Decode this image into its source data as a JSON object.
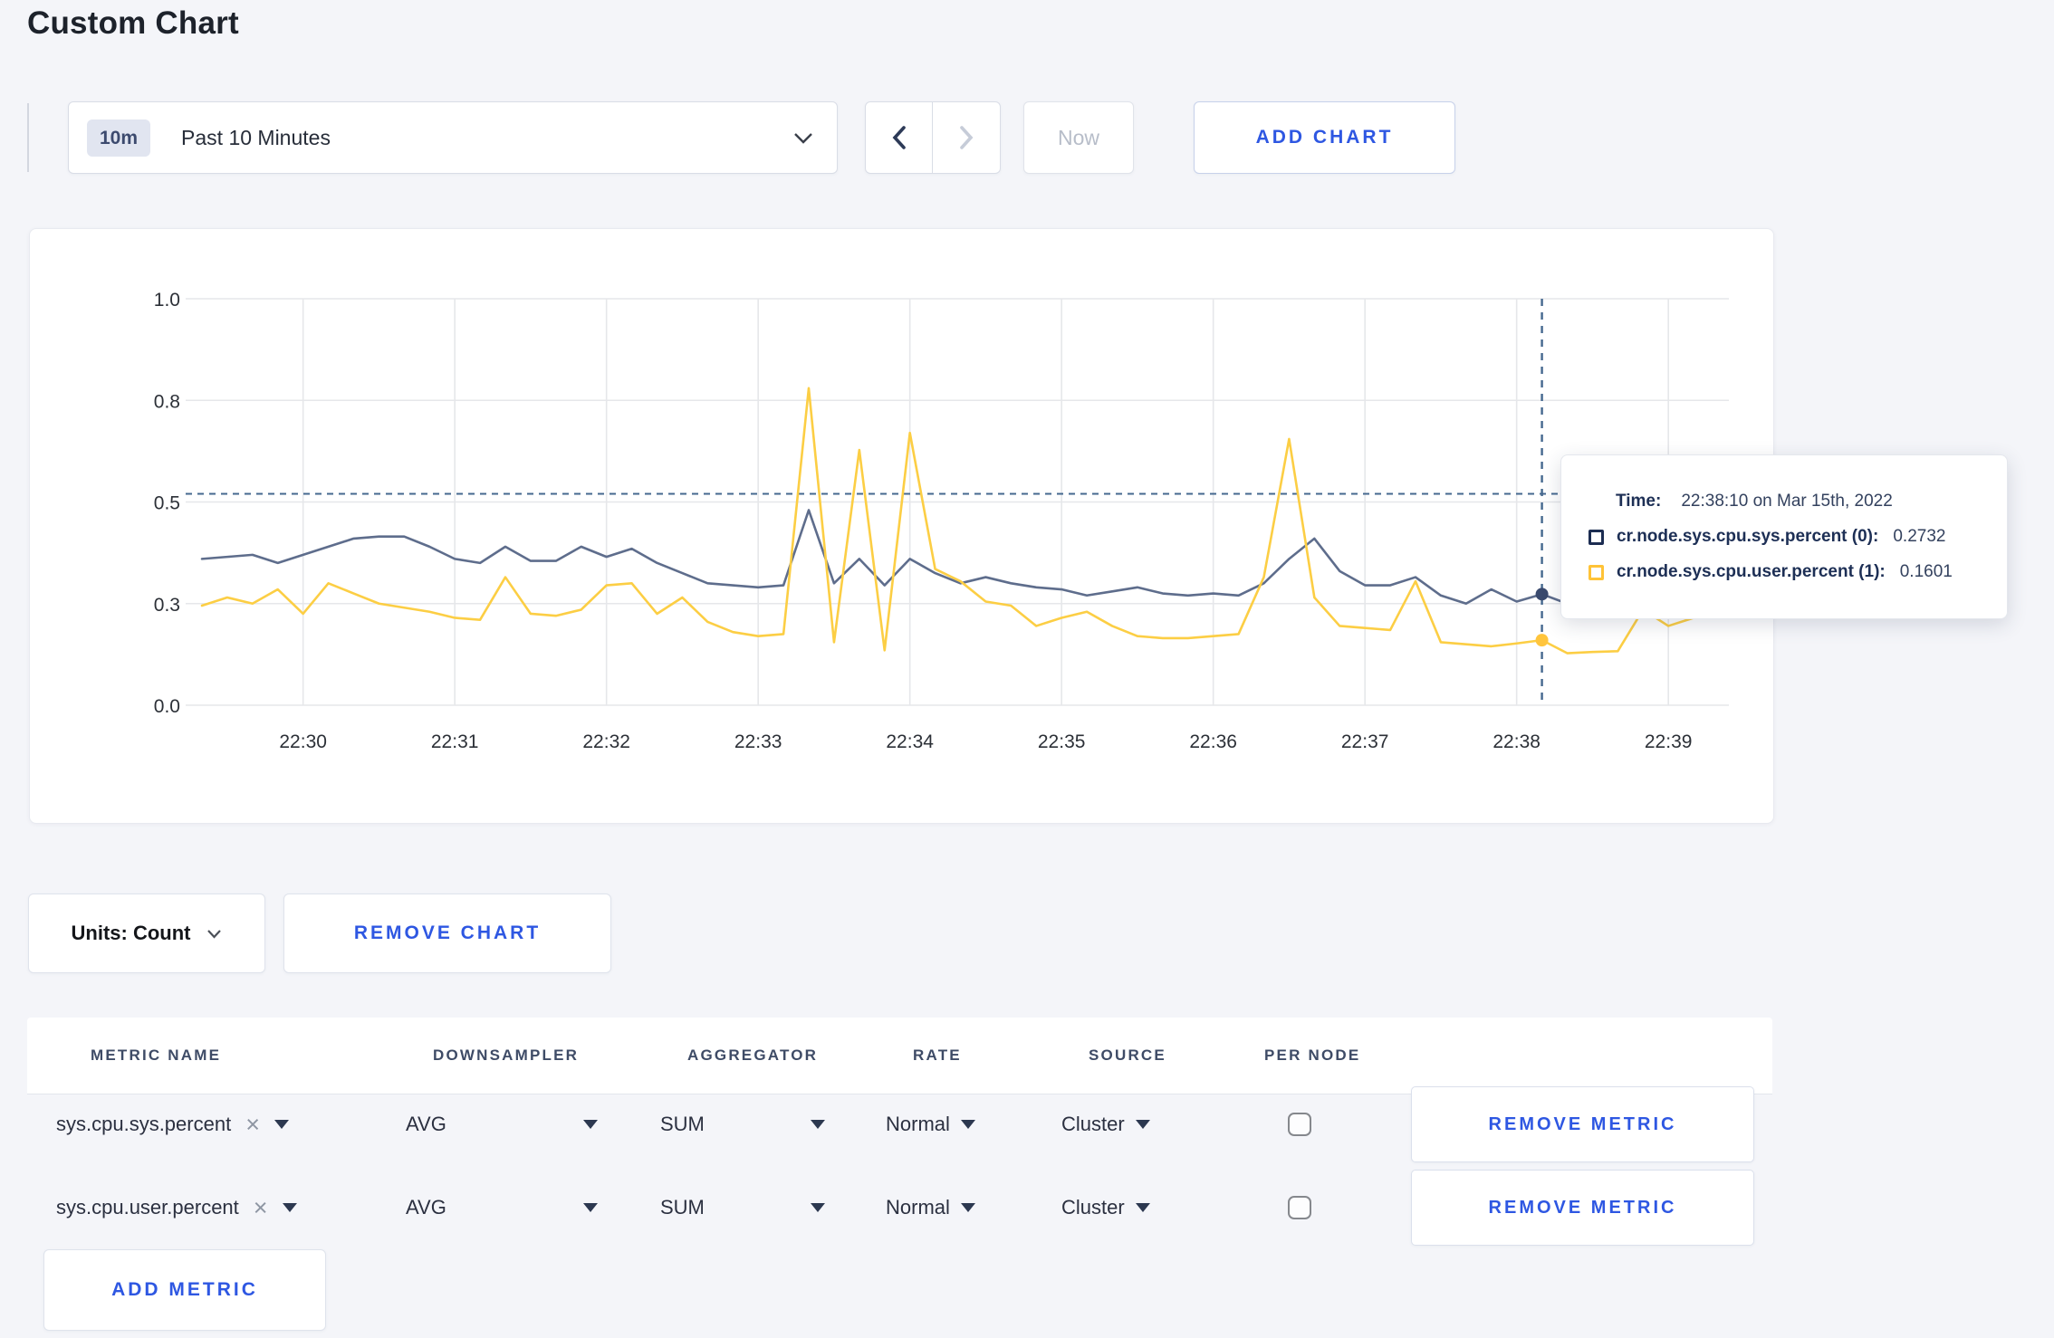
{
  "page": {
    "title": "Custom Chart"
  },
  "toolbar": {
    "range_badge": "10m",
    "range_label": "Past 10 Minutes",
    "now_label": "Now",
    "add_chart_label": "ADD CHART"
  },
  "tooltip": {
    "time_label": "Time:",
    "time_value": "22:38:10 on Mar 15th, 2022",
    "rows": [
      {
        "name": "cr.node.sys.cpu.sys.percent (0):",
        "value": "0.2732",
        "swatch_color": "#1c2d52"
      },
      {
        "name": "cr.node.sys.cpu.user.percent (1):",
        "value": "0.1601",
        "swatch_color": "#ffc337"
      }
    ]
  },
  "chart_data": {
    "type": "line",
    "title": "",
    "x_start": "22:29:20",
    "x_step_seconds": 10,
    "x_ticks": [
      {
        "label": "22:30",
        "index": 4
      },
      {
        "label": "22:31",
        "index": 10
      },
      {
        "label": "22:32",
        "index": 16
      },
      {
        "label": "22:33",
        "index": 22
      },
      {
        "label": "22:34",
        "index": 28
      },
      {
        "label": "22:35",
        "index": 34
      },
      {
        "label": "22:36",
        "index": 40
      },
      {
        "label": "22:37",
        "index": 46
      },
      {
        "label": "22:38",
        "index": 52
      },
      {
        "label": "22:39",
        "index": 58
      }
    ],
    "y_ticks": [
      {
        "label": "0.0",
        "value": 0
      },
      {
        "label": "0.3",
        "value": 0.25
      },
      {
        "label": "0.5",
        "value": 0.5
      },
      {
        "label": "0.8",
        "value": 0.75
      },
      {
        "label": "1.0",
        "value": 1
      }
    ],
    "ylim": [
      0,
      1
    ],
    "grid": true,
    "legend_position": "none",
    "threshold_line_value": 0.52,
    "crosshair": {
      "index": 53,
      "time": "22:38:10",
      "sys_value": 0.2732,
      "user_value": 0.1601
    },
    "series": [
      {
        "name": "cr.node.sys.cpu.sys.percent",
        "color": "#5e6d8c",
        "dot_color": "#3a4a6e",
        "values": [
          0.36,
          0.365,
          0.37,
          0.35,
          0.37,
          0.39,
          0.41,
          0.415,
          0.415,
          0.39,
          0.36,
          0.35,
          0.39,
          0.355,
          0.355,
          0.39,
          0.365,
          0.385,
          0.35,
          0.325,
          0.3,
          0.295,
          0.29,
          0.295,
          0.48,
          0.3,
          0.36,
          0.295,
          0.36,
          0.325,
          0.3,
          0.315,
          0.3,
          0.29,
          0.285,
          0.27,
          0.28,
          0.29,
          0.275,
          0.27,
          0.275,
          0.27,
          0.3,
          0.36,
          0.41,
          0.33,
          0.295,
          0.295,
          0.315,
          0.27,
          0.25,
          0.285,
          0.255,
          0.2732,
          0.25,
          0.26,
          0.285,
          0.295,
          0.29,
          0.3,
          0.31
        ]
      },
      {
        "name": "cr.node.sys.cpu.user.percent",
        "color": "#fcce44",
        "dot_color": "#ffc53d",
        "values": [
          0.245,
          0.265,
          0.25,
          0.285,
          0.225,
          0.3,
          0.275,
          0.25,
          0.24,
          0.23,
          0.215,
          0.21,
          0.315,
          0.225,
          0.22,
          0.235,
          0.295,
          0.3,
          0.225,
          0.265,
          0.205,
          0.18,
          0.17,
          0.175,
          0.78,
          0.155,
          0.628,
          0.135,
          0.67,
          0.335,
          0.305,
          0.255,
          0.245,
          0.195,
          0.215,
          0.23,
          0.195,
          0.17,
          0.165,
          0.165,
          0.17,
          0.175,
          0.315,
          0.655,
          0.265,
          0.195,
          0.19,
          0.185,
          0.305,
          0.155,
          0.15,
          0.145,
          0.152,
          0.1601,
          0.128,
          0.131,
          0.133,
          0.235,
          0.195,
          0.215,
          0.285
        ]
      }
    ]
  },
  "chart_footer": {
    "units_label": "Units: Count",
    "remove_chart_label": "REMOVE CHART"
  },
  "metrics_table": {
    "headers": [
      "METRIC NAME",
      "DOWNSAMPLER",
      "AGGREGATOR",
      "RATE",
      "SOURCE",
      "PER NODE"
    ],
    "rows": [
      {
        "metric": "sys.cpu.sys.percent",
        "downsampler": "AVG",
        "aggregator": "SUM",
        "rate": "Normal",
        "source": "Cluster",
        "per_node_checked": false,
        "remove_label": "REMOVE METRIC"
      },
      {
        "metric": "sys.cpu.user.percent",
        "downsampler": "AVG",
        "aggregator": "SUM",
        "rate": "Normal",
        "source": "Cluster",
        "per_node_checked": false,
        "remove_label": "REMOVE METRIC"
      }
    ],
    "add_metric_label": "ADD METRIC"
  },
  "colors": {
    "accent_blue": "#2e57e2",
    "page_bg": "#f4f5f9",
    "grid": "#e6e7ea",
    "crosshair": "#45688f"
  }
}
